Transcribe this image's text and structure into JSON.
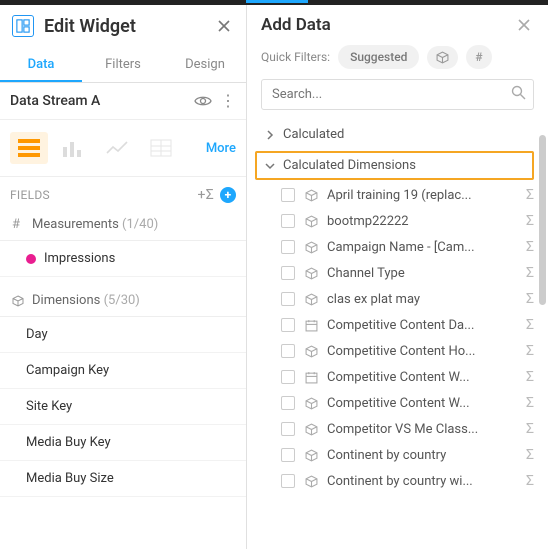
{
  "left": {
    "title": "Edit Widget",
    "tabs": {
      "data": "Data",
      "filters": "Filters",
      "design": "Design"
    },
    "stream_name": "Data Stream A",
    "more": "More",
    "fields_label": "FIELDS",
    "add_sigma": "+Σ",
    "measurements": {
      "label": "Measurements",
      "count": "(1/40)",
      "items": [
        "Impressions"
      ]
    },
    "dimensions": {
      "label": "Dimensions",
      "count": "(5/30)",
      "items": [
        "Day",
        "Campaign Key",
        "Site Key",
        "Media Buy Key",
        "Media Buy Size"
      ]
    }
  },
  "right": {
    "title": "Add Data",
    "quick_filters_label": "Quick Filters:",
    "suggested": "Suggested",
    "search_placeholder": "Search...",
    "groups": {
      "calculated": "Calculated",
      "calc_dims": "Calculated Dimensions"
    },
    "fields": [
      {
        "icon": "cube",
        "name": "April training 19 (replac..."
      },
      {
        "icon": "cube",
        "name": "bootmp22222"
      },
      {
        "icon": "cube",
        "name": "Campaign Name - [Cam..."
      },
      {
        "icon": "cube",
        "name": "Channel Type"
      },
      {
        "icon": "cube",
        "name": "clas ex plat may"
      },
      {
        "icon": "cal",
        "name": "Competitive Content Da..."
      },
      {
        "icon": "cube",
        "name": "Competitive Content Ho..."
      },
      {
        "icon": "cal",
        "name": "Competitive Content W..."
      },
      {
        "icon": "cube",
        "name": "Competitive Content W..."
      },
      {
        "icon": "cube",
        "name": "Competitor VS Me Class..."
      },
      {
        "icon": "cube",
        "name": "Continent by country"
      },
      {
        "icon": "cube",
        "name": "Continent by country wi..."
      }
    ]
  }
}
